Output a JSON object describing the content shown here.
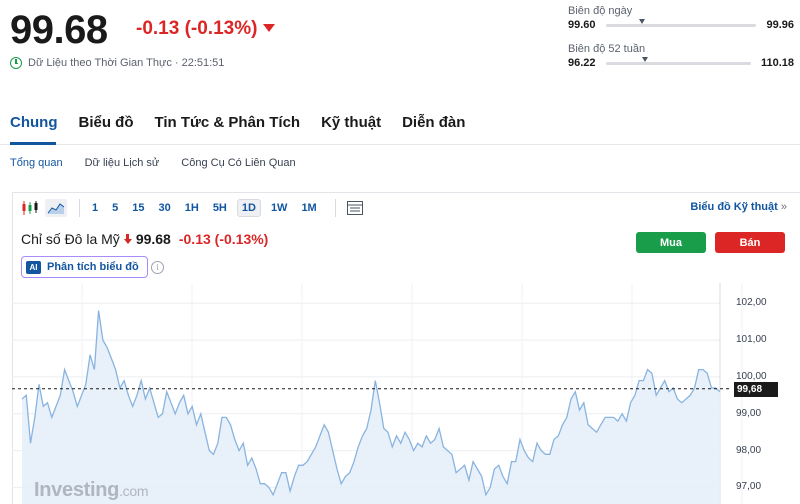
{
  "quote": {
    "price": "99.68",
    "change": "-0.13 (-0.13%)",
    "realtime_label": "Dữ Liệu theo Thời Gian Thực · 22:51:51"
  },
  "ranges": {
    "day": {
      "label": "Biên độ ngày",
      "low": "99.60",
      "high": "99.96",
      "position": 0.22
    },
    "week52": {
      "label": "Biên độ 52 tuần",
      "low": "96.22",
      "high": "110.18",
      "position": 0.25
    }
  },
  "main_tabs": [
    {
      "label": "Chung",
      "active": true
    },
    {
      "label": "Biểu đồ",
      "active": false
    },
    {
      "label": "Tin Tức & Phân Tích",
      "active": false
    },
    {
      "label": "Kỹ thuật",
      "active": false
    },
    {
      "label": "Diễn đàn",
      "active": false
    }
  ],
  "sub_tabs": [
    {
      "label": "Tổng quan",
      "active": true
    },
    {
      "label": "Dữ liệu Lịch sử",
      "active": false
    },
    {
      "label": "Công Cụ Có Liên Quan",
      "active": false
    }
  ],
  "toolbar": {
    "timeframes": [
      "1",
      "5",
      "15",
      "30",
      "1H",
      "5H",
      "1D",
      "1W",
      "1M"
    ],
    "active_timeframe": "1D",
    "tech_chart_label": "Biểu đồ Kỹ thuật",
    "tech_chart_chevron": "»"
  },
  "chart_header": {
    "name": "Chỉ số Đô la Mỹ",
    "price": "99.68",
    "change": "-0.13 (-0.13%)",
    "ai_badge": "AI",
    "ai_label": "Phân tích biểu đồ",
    "info_glyph": "i",
    "buy_label": "Mua",
    "sell_label": "Bán"
  },
  "watermark": {
    "brand": "Investing",
    "suffix": ".com"
  },
  "colors": {
    "accent": "#1256a0",
    "up": "#1a9d4a",
    "down": "#dc2626",
    "line": "#89b4e0",
    "fill": "#e6eef8"
  },
  "chart_data": {
    "type": "area",
    "title": "",
    "xlabel": "",
    "ylabel": "",
    "ylim": [
      96.55,
      102.55
    ],
    "yticks": [
      97.0,
      98.0,
      99.0,
      100.0,
      101.0,
      102.0
    ],
    "ytick_labels": [
      "97,00",
      "98,00",
      "99,00",
      "100,00",
      "101,00",
      "102,00"
    ],
    "last_value": 99.68,
    "last_label": "99,68",
    "grid": true,
    "series": [
      {
        "values": [
          99.4,
          99.5,
          98.2,
          98.9,
          99.8,
          99.2,
          99.3,
          98.9,
          99.2,
          99.5,
          100.2,
          99.9,
          99.6,
          99.2,
          99.5,
          99.8,
          100.6,
          100.2,
          101.8,
          101.0,
          100.8,
          100.5,
          100.2,
          99.7,
          99.9,
          99.5,
          99.2,
          99.5,
          99.9,
          99.4,
          99.7,
          99.3,
          98.9,
          99.0,
          99.6,
          99.3,
          99.0,
          99.3,
          99.5,
          99.0,
          99.2,
          98.7,
          99.0,
          98.5,
          98.0,
          97.9,
          98.2,
          98.9,
          98.9,
          98.7,
          98.3,
          98.0,
          98.2,
          97.6,
          97.8,
          97.5,
          97.1,
          97.1,
          97.0,
          96.8,
          97.1,
          97.4,
          97.4,
          96.9,
          97.3,
          97.6,
          97.6,
          97.7,
          97.9,
          98.1,
          98.4,
          98.7,
          98.5,
          98.0,
          97.5,
          97.1,
          97.3,
          97.4,
          97.7,
          98.1,
          98.4,
          98.6,
          99.1,
          99.9,
          99.3,
          98.6,
          98.5,
          98.1,
          98.4,
          98.2,
          98.5,
          98.3,
          98.0,
          98.2,
          98.1,
          98.4,
          98.2,
          98.3,
          98.6,
          98.1,
          98.0,
          97.9,
          97.4,
          97.5,
          97.6,
          97.2,
          97.7,
          97.5,
          97.3,
          96.8,
          97.0,
          97.5,
          97.6,
          97.3,
          97.1,
          97.7,
          97.7,
          98.3,
          98.0,
          97.8,
          97.7,
          98.2,
          98.0,
          97.9,
          97.9,
          98.3,
          98.4,
          98.7,
          98.9,
          99.4,
          99.6,
          99.1,
          99.3,
          98.7,
          98.6,
          98.5,
          98.7,
          98.9,
          98.9,
          98.9,
          98.8,
          99.0,
          98.8,
          99.3,
          99.5,
          99.9,
          99.9,
          100.2,
          100.1,
          99.5,
          99.7,
          99.9,
          99.6,
          99.7,
          99.4,
          99.3,
          99.4,
          99.5,
          99.7,
          100.2,
          100.2,
          100.1,
          99.7,
          99.7,
          99.6
        ]
      }
    ]
  }
}
